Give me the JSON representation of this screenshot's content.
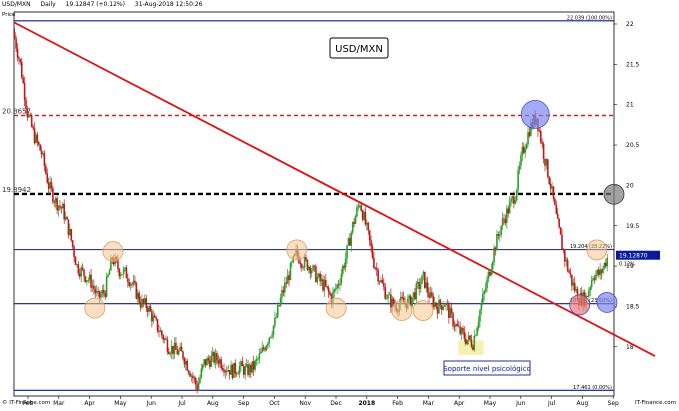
{
  "header": {
    "symbol": "USD/MXN",
    "period": "Daily",
    "quote": "19.12847 (+0.12%)",
    "datetime": "31-Aug-2018 12:50:26",
    "axis_label": "Price"
  },
  "footer": {
    "copyright_left": "© IT-Finance.com",
    "copyright_right": "IT-Finance.com"
  },
  "colors": {
    "up": "#2a9d2a",
    "down": "#c01818",
    "fib_line": "#0a1a9a",
    "trendline": "#e01010",
    "dashed_red": "#d42020",
    "dashed_black": "#000000",
    "orange_marker": "#f5c48f",
    "blue_marker": "#7f86ef",
    "red_marker": "#ef7a7a",
    "gray_marker": "#7a7a7a",
    "yellow_box": "#f3f0a8",
    "current_price_box": "#0a1a9a"
  },
  "chart_data": {
    "type": "candlestick",
    "title": "USD/MXN",
    "annotation": "Soporte nivel psicológico",
    "ylim": [
      17.4,
      22.05
    ],
    "y_ticks": [
      "22",
      "21.5",
      "21",
      "20.5",
      "20",
      "19.5",
      "19",
      "18.5",
      "18"
    ],
    "x_ticks": [
      "Feb",
      "Mar",
      "Apr",
      "May",
      "Jun",
      "Jul",
      "Aug",
      "Sep",
      "Oct",
      "Nov",
      "Dec",
      "2018",
      "Feb",
      "Mar",
      "Apr",
      "May",
      "Jun",
      "Jul",
      "Aug",
      "Sep"
    ],
    "x_range": [
      "2017-01-20",
      "2018-09-06"
    ],
    "fib_levels": [
      {
        "value": 22.039,
        "label": "22.039 (100.00%)"
      },
      {
        "value": 19.204,
        "label": "19.204 (28.22%)"
      },
      {
        "value": 18.534,
        "label": "18.534 (23.60%)"
      },
      {
        "value": 17.461,
        "label": "17.461 (0.00%)"
      }
    ],
    "dashed_levels": [
      {
        "value": 20.8657,
        "label": "20.8657",
        "color": "red"
      },
      {
        "value": 19.8942,
        "label": "19.8942",
        "color": "black"
      }
    ],
    "current_price": {
      "value": 19.1287,
      "label": "19.12870",
      "change": "0.12%"
    },
    "trendline": {
      "start": [
        "2017-01-20",
        22.02
      ],
      "end": [
        "2018-09-06",
        18.15
      ]
    },
    "price_path": [
      [
        "2017-01-20",
        21.9
      ],
      [
        "2017-01-27",
        21.5
      ],
      [
        "2017-02-03",
        20.9
      ],
      [
        "2017-02-10",
        20.6
      ],
      [
        "2017-02-17",
        20.4
      ],
      [
        "2017-02-24",
        20.0
      ],
      [
        "2017-03-03",
        19.8
      ],
      [
        "2017-03-10",
        19.7
      ],
      [
        "2017-03-17",
        19.4
      ],
      [
        "2017-03-24",
        19.0
      ],
      [
        "2017-03-31",
        18.9
      ],
      [
        "2017-04-07",
        18.8
      ],
      [
        "2017-04-14",
        18.6
      ],
      [
        "2017-04-21",
        18.7
      ],
      [
        "2017-04-28",
        19.1
      ],
      [
        "2017-05-05",
        18.95
      ],
      [
        "2017-05-12",
        18.9
      ],
      [
        "2017-05-19",
        18.75
      ],
      [
        "2017-05-26",
        18.55
      ],
      [
        "2017-06-02",
        18.5
      ],
      [
        "2017-06-09",
        18.3
      ],
      [
        "2017-06-16",
        18.15
      ],
      [
        "2017-06-23",
        18.0
      ],
      [
        "2017-06-30",
        17.95
      ],
      [
        "2017-07-07",
        17.9
      ],
      [
        "2017-07-14",
        17.7
      ],
      [
        "2017-07-21",
        17.5
      ],
      [
        "2017-07-28",
        17.8
      ],
      [
        "2017-08-04",
        17.85
      ],
      [
        "2017-08-11",
        17.85
      ],
      [
        "2017-08-18",
        17.75
      ],
      [
        "2017-08-25",
        17.7
      ],
      [
        "2017-09-01",
        17.75
      ],
      [
        "2017-09-08",
        17.7
      ],
      [
        "2017-09-15",
        17.75
      ],
      [
        "2017-09-22",
        17.9
      ],
      [
        "2017-09-29",
        18.1
      ],
      [
        "2017-10-06",
        18.3
      ],
      [
        "2017-10-13",
        18.65
      ],
      [
        "2017-10-20",
        18.9
      ],
      [
        "2017-10-27",
        19.15
      ],
      [
        "2017-11-03",
        19.05
      ],
      [
        "2017-11-10",
        19.0
      ],
      [
        "2017-11-17",
        18.85
      ],
      [
        "2017-11-24",
        18.75
      ],
      [
        "2017-12-01",
        18.6
      ],
      [
        "2017-12-08",
        18.8
      ],
      [
        "2017-12-15",
        19.1
      ],
      [
        "2017-12-22",
        19.5
      ],
      [
        "2017-12-29",
        19.8
      ],
      [
        "2018-01-05",
        19.45
      ],
      [
        "2018-01-12",
        19.05
      ],
      [
        "2018-01-19",
        18.8
      ],
      [
        "2018-01-26",
        18.6
      ],
      [
        "2018-02-02",
        18.5
      ],
      [
        "2018-02-09",
        18.55
      ],
      [
        "2018-02-16",
        18.55
      ],
      [
        "2018-02-23",
        18.7
      ],
      [
        "2018-03-02",
        18.85
      ],
      [
        "2018-03-09",
        18.6
      ],
      [
        "2018-03-16",
        18.5
      ],
      [
        "2018-03-23",
        18.55
      ],
      [
        "2018-03-30",
        18.35
      ],
      [
        "2018-04-06",
        18.2
      ],
      [
        "2018-04-13",
        18.1
      ],
      [
        "2018-04-20",
        18.05
      ],
      [
        "2018-04-27",
        18.45
      ],
      [
        "2018-05-04",
        18.8
      ],
      [
        "2018-05-11",
        19.2
      ],
      [
        "2018-05-18",
        19.5
      ],
      [
        "2018-05-25",
        19.7
      ],
      [
        "2018-06-01",
        19.9
      ],
      [
        "2018-06-08",
        20.4
      ],
      [
        "2018-06-15",
        20.7
      ],
      [
        "2018-06-22",
        20.85
      ],
      [
        "2018-06-29",
        20.4
      ],
      [
        "2018-07-06",
        20.0
      ],
      [
        "2018-07-13",
        19.5
      ],
      [
        "2018-07-20",
        19.1
      ],
      [
        "2018-07-27",
        18.8
      ],
      [
        "2018-08-03",
        18.6
      ],
      [
        "2018-08-10",
        18.6
      ],
      [
        "2018-08-17",
        18.9
      ],
      [
        "2018-08-24",
        18.9
      ],
      [
        "2018-08-31",
        19.1
      ]
    ],
    "markers": [
      {
        "date": "2018-06-20",
        "value": 20.88,
        "color": "blue"
      },
      {
        "date": "2018-09-06",
        "value": 19.89,
        "color": "gray"
      },
      {
        "date": "2017-04-28",
        "value": 19.18,
        "color": "orange"
      },
      {
        "date": "2017-10-27",
        "value": 19.2,
        "color": "orange"
      },
      {
        "date": "2018-08-20",
        "value": 19.2,
        "color": "orange"
      },
      {
        "date": "2017-04-10",
        "value": 18.48,
        "color": "orange"
      },
      {
        "date": "2017-12-05",
        "value": 18.48,
        "color": "orange"
      },
      {
        "date": "2018-02-08",
        "value": 18.45,
        "color": "orange"
      },
      {
        "date": "2018-03-01",
        "value": 18.45,
        "color": "orange"
      },
      {
        "date": "2018-08-03",
        "value": 18.52,
        "color": "red"
      },
      {
        "date": "2018-08-30",
        "value": 18.55,
        "color": "blue"
      }
    ],
    "highlight": {
      "date_from": "2018-04-05",
      "date_to": "2018-04-30",
      "value_low": 17.9,
      "value_high": 18.08
    }
  }
}
